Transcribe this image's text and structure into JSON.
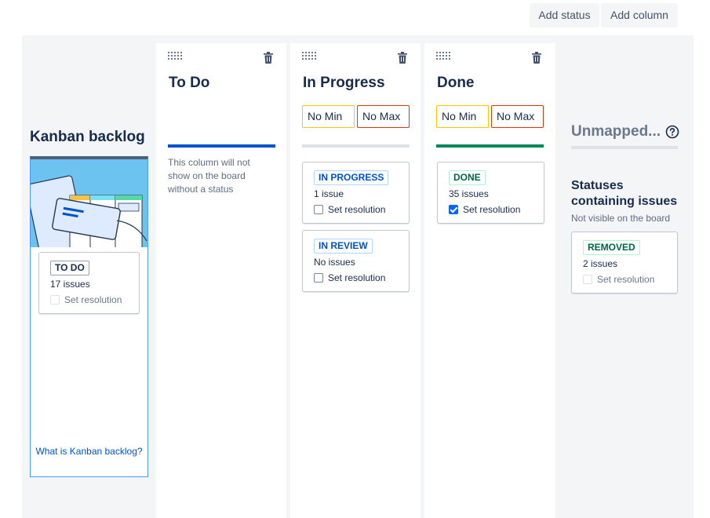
{
  "toolbar": {
    "add_status": "Add status",
    "add_column": "Add column"
  },
  "backlog": {
    "title": "Kanban backlog",
    "card": {
      "status": "TO DO",
      "count": "17 issues",
      "resolution": "Set resolution",
      "resolution_checked": false
    },
    "link": "What is Kanban backlog?"
  },
  "columns": [
    {
      "title": "To Do",
      "empty_note": "This column will not show on the board without a status"
    },
    {
      "title": "In Progress",
      "min": "No Min",
      "max": "No Max",
      "cards": [
        {
          "status": "IN PROGRESS",
          "count": "1 issue",
          "resolution": "Set resolution",
          "resolution_checked": false
        },
        {
          "status": "IN REVIEW",
          "count": "No issues",
          "resolution": "Set resolution",
          "resolution_checked": false
        }
      ]
    },
    {
      "title": "Done",
      "min": "No Min",
      "max": "No Max",
      "cards": [
        {
          "status": "DONE",
          "count": "35 issues",
          "resolution": "Set resolution",
          "resolution_checked": true
        }
      ]
    }
  ],
  "unmapped": {
    "title": "Unmapped...",
    "statuses_title": "Statuses containing issues",
    "not_visible": "Not visible on the board",
    "card": {
      "status": "REMOVED",
      "count": "2 issues",
      "resolution": "Set resolution",
      "resolution_checked": false
    }
  },
  "colors": {
    "todo_bar": "#0052cc",
    "inprogress_bar": "#dfe1e6",
    "done_bar": "#00875a",
    "min_border": "#ffc400",
    "max_border": "#de350b",
    "link": "#0052cc"
  },
  "icons": [
    "drag-handle-icon",
    "trash-icon",
    "help-icon",
    "checkbox-icon"
  ]
}
